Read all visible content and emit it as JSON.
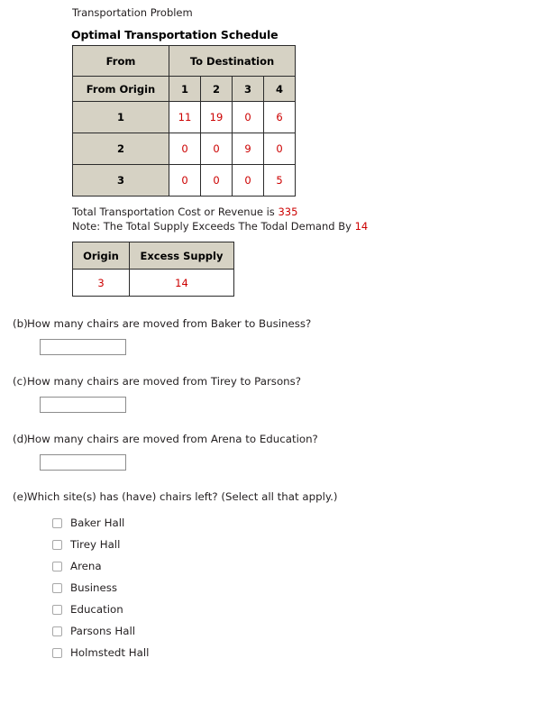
{
  "solver": {
    "problem_title": "Transportation Problem",
    "schedule_heading": "Optimal Transportation Schedule",
    "schedule_table": {
      "from_header": "From",
      "to_header": "To Destination",
      "origin_header": "From Origin",
      "destination_labels": [
        "1",
        "2",
        "3",
        "4"
      ],
      "rows": [
        {
          "origin": "1",
          "values": [
            "11",
            "19",
            "0",
            "6"
          ]
        },
        {
          "origin": "2",
          "values": [
            "0",
            "0",
            "9",
            "0"
          ]
        },
        {
          "origin": "3",
          "values": [
            "0",
            "0",
            "0",
            "5"
          ]
        }
      ]
    },
    "total_cost_prefix": "Total Transportation Cost or Revenue is",
    "total_cost_value": "335",
    "note_prefix": "Note: The Total Supply Exceeds The Todal Demand By",
    "note_value": "14",
    "excess_table": {
      "origin_header": "Origin",
      "supply_header": "Excess Supply",
      "origin_value": "3",
      "supply_value": "14"
    },
    "colors": {
      "value_red": "#cc0000",
      "header_fill": "#d6d2c4",
      "border": "#2b2b2b"
    }
  },
  "questions": [
    {
      "label": "(b)",
      "text": "How many chairs are moved from Baker to Business?",
      "answer_value": ""
    },
    {
      "label": "(c)",
      "text": "How many chairs are moved from Tirey to Parsons?",
      "answer_value": ""
    },
    {
      "label": "(d)",
      "text": "How many chairs are moved from Arena to Education?",
      "answer_value": ""
    }
  ],
  "multi_select": {
    "label": "(e)",
    "text": "Which site(s) has (have) chairs left? (Select all that apply.)",
    "options": [
      "Baker Hall",
      "Tirey Hall",
      "Arena",
      "Business",
      "Education",
      "Parsons Hall",
      "Holmstedt Hall"
    ]
  }
}
